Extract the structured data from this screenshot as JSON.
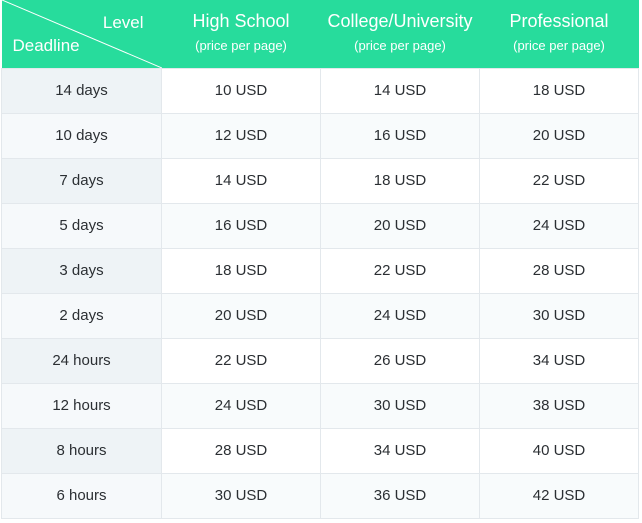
{
  "header": {
    "corner": {
      "level_label": "Level",
      "deadline_label": "Deadline"
    },
    "columns": [
      {
        "title": "High School",
        "subtitle": "(price per page)"
      },
      {
        "title": "College/University",
        "subtitle": "(price per page)"
      },
      {
        "title": "Professional",
        "subtitle": "(price per page)"
      }
    ]
  },
  "rows": [
    {
      "deadline": "14 days",
      "prices": [
        "10 USD",
        "14 USD",
        "18 USD"
      ]
    },
    {
      "deadline": "10 days",
      "prices": [
        "12 USD",
        "16 USD",
        "20 USD"
      ]
    },
    {
      "deadline": "7 days",
      "prices": [
        "14 USD",
        "18 USD",
        "22 USD"
      ]
    },
    {
      "deadline": "5 days",
      "prices": [
        "16 USD",
        "20 USD",
        "24 USD"
      ]
    },
    {
      "deadline": "3 days",
      "prices": [
        "18 USD",
        "22 USD",
        "28 USD"
      ]
    },
    {
      "deadline": "2 days",
      "prices": [
        "20 USD",
        "24 USD",
        "30 USD"
      ]
    },
    {
      "deadline": "24 hours",
      "prices": [
        "22 USD",
        "26 USD",
        "34 USD"
      ]
    },
    {
      "deadline": "12 hours",
      "prices": [
        "24 USD",
        "30 USD",
        "38 USD"
      ]
    },
    {
      "deadline": "8 hours",
      "prices": [
        "28 USD",
        "34 USD",
        "40 USD"
      ]
    },
    {
      "deadline": "6 hours",
      "prices": [
        "30 USD",
        "36 USD",
        "42 USD"
      ]
    }
  ],
  "colors": {
    "header_bg": "#27dc9c",
    "header_text": "#ffffff",
    "deadline_col_bg": "#eef3f6",
    "border": "#e3e8ec",
    "cell_text": "#2b2f33"
  }
}
